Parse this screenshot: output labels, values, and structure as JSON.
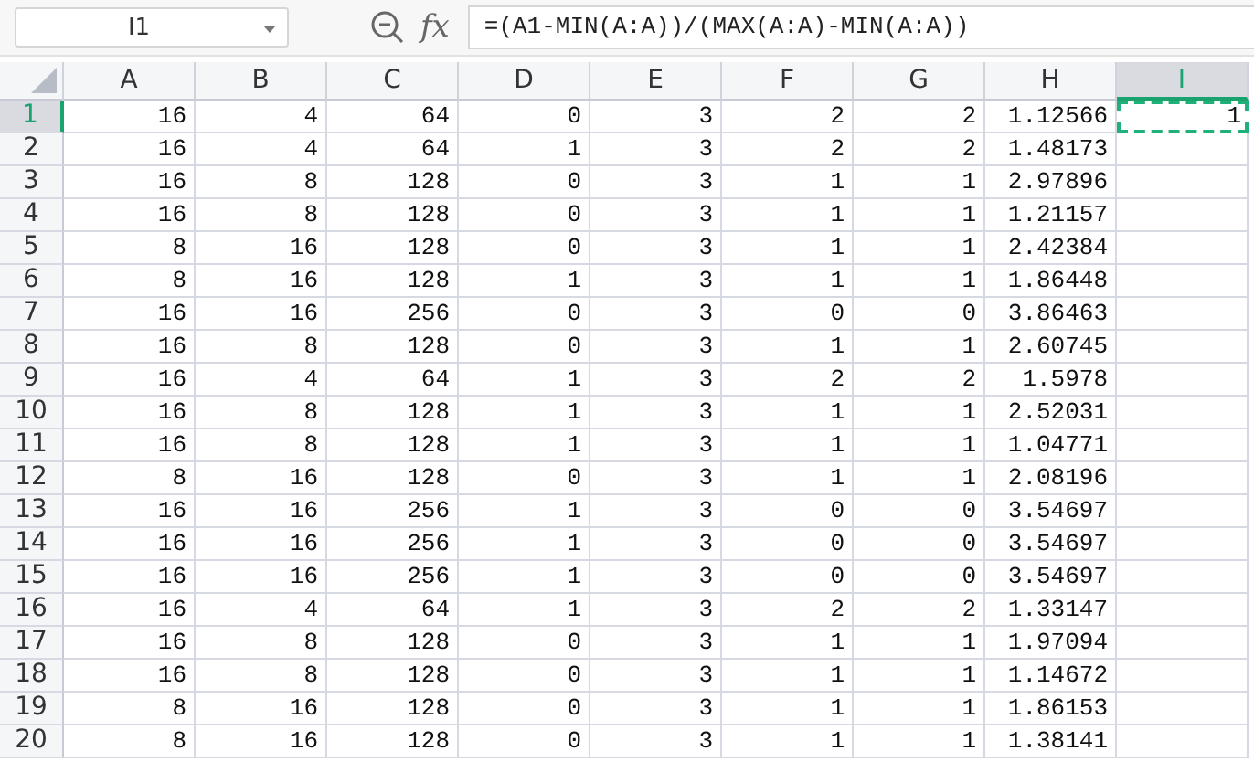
{
  "name_box": {
    "value": "I1"
  },
  "formula_bar": {
    "function_label": "fx",
    "formula": "=(A1-MIN(A:A))/(MAX(A:A)-MIN(A:A))"
  },
  "columns": [
    {
      "label": "A",
      "selected": false
    },
    {
      "label": "B",
      "selected": false
    },
    {
      "label": "C",
      "selected": false
    },
    {
      "label": "D",
      "selected": false
    },
    {
      "label": "E",
      "selected": false
    },
    {
      "label": "F",
      "selected": false
    },
    {
      "label": "G",
      "selected": false
    },
    {
      "label": "H",
      "selected": false
    },
    {
      "label": "I",
      "selected": true
    }
  ],
  "rows": [
    {
      "label": "1",
      "selected": true,
      "cells": [
        "16",
        "4",
        "64",
        "0",
        "3",
        "2",
        "2",
        "1.12566",
        "1"
      ]
    },
    {
      "label": "2",
      "selected": false,
      "cells": [
        "16",
        "4",
        "64",
        "1",
        "3",
        "2",
        "2",
        "1.48173"
      ]
    },
    {
      "label": "3",
      "selected": false,
      "cells": [
        "16",
        "8",
        "128",
        "0",
        "3",
        "1",
        "1",
        "2.97896"
      ]
    },
    {
      "label": "4",
      "selected": false,
      "cells": [
        "16",
        "8",
        "128",
        "0",
        "3",
        "1",
        "1",
        "1.21157"
      ]
    },
    {
      "label": "5",
      "selected": false,
      "cells": [
        "8",
        "16",
        "128",
        "0",
        "3",
        "1",
        "1",
        "2.42384"
      ]
    },
    {
      "label": "6",
      "selected": false,
      "cells": [
        "8",
        "16",
        "128",
        "1",
        "3",
        "1",
        "1",
        "1.86448"
      ]
    },
    {
      "label": "7",
      "selected": false,
      "cells": [
        "16",
        "16",
        "256",
        "0",
        "3",
        "0",
        "0",
        "3.86463"
      ]
    },
    {
      "label": "8",
      "selected": false,
      "cells": [
        "16",
        "8",
        "128",
        "0",
        "3",
        "1",
        "1",
        "2.60745"
      ]
    },
    {
      "label": "9",
      "selected": false,
      "cells": [
        "16",
        "4",
        "64",
        "1",
        "3",
        "2",
        "2",
        "1.5978"
      ]
    },
    {
      "label": "10",
      "selected": false,
      "cells": [
        "16",
        "8",
        "128",
        "1",
        "3",
        "1",
        "1",
        "2.52031"
      ]
    },
    {
      "label": "11",
      "selected": false,
      "cells": [
        "16",
        "8",
        "128",
        "1",
        "3",
        "1",
        "1",
        "1.04771"
      ]
    },
    {
      "label": "12",
      "selected": false,
      "cells": [
        "8",
        "16",
        "128",
        "0",
        "3",
        "1",
        "1",
        "2.08196"
      ]
    },
    {
      "label": "13",
      "selected": false,
      "cells": [
        "16",
        "16",
        "256",
        "1",
        "3",
        "0",
        "0",
        "3.54697"
      ]
    },
    {
      "label": "14",
      "selected": false,
      "cells": [
        "16",
        "16",
        "256",
        "1",
        "3",
        "0",
        "0",
        "3.54697"
      ]
    },
    {
      "label": "15",
      "selected": false,
      "cells": [
        "16",
        "16",
        "256",
        "1",
        "3",
        "0",
        "0",
        "3.54697"
      ]
    },
    {
      "label": "16",
      "selected": false,
      "cells": [
        "16",
        "4",
        "64",
        "1",
        "3",
        "2",
        "2",
        "1.33147"
      ]
    },
    {
      "label": "17",
      "selected": false,
      "cells": [
        "16",
        "8",
        "128",
        "0",
        "3",
        "1",
        "1",
        "1.97094"
      ]
    },
    {
      "label": "18",
      "selected": false,
      "cells": [
        "16",
        "8",
        "128",
        "0",
        "3",
        "1",
        "1",
        "1.14672"
      ]
    },
    {
      "label": "19",
      "selected": false,
      "cells": [
        "8",
        "16",
        "128",
        "0",
        "3",
        "1",
        "1",
        "1.86153"
      ]
    },
    {
      "label": "20",
      "selected": false,
      "cells": [
        "8",
        "16",
        "128",
        "0",
        "3",
        "1",
        "1",
        "1.38141"
      ]
    }
  ]
}
